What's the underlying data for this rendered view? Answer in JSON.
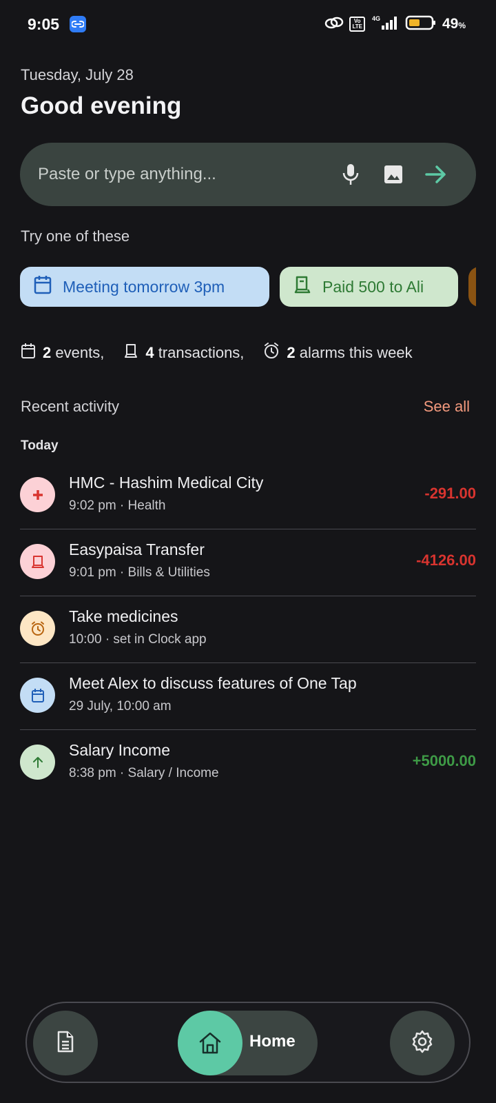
{
  "status_bar": {
    "time": "9:05",
    "network": "4G",
    "volte": "Vo\nLTE",
    "battery_percent": "49",
    "battery_unit": "%",
    "battery_level": 0.49
  },
  "header": {
    "date": "Tuesday, July 28",
    "greeting": "Good evening"
  },
  "composer": {
    "placeholder": "Paste or type anything..."
  },
  "suggestions": {
    "label": "Try one of these",
    "chips": [
      {
        "label": "Meeting tomorrow 3pm",
        "icon": "calendar-icon",
        "color": "#c3ddf5"
      },
      {
        "label": "Paid 500 to Ali",
        "icon": "receipt-icon",
        "color": "#cfe7cd"
      }
    ]
  },
  "summary": {
    "events_count": "2",
    "events_label": "events,",
    "transactions_count": "4",
    "transactions_label": "transactions,",
    "alarms_count": "2",
    "alarms_label": "alarms this week"
  },
  "recent": {
    "label": "Recent activity",
    "see_all": "See all",
    "group": "Today",
    "items": [
      {
        "title": "HMC - Hashim Medical City",
        "subtitle": "9:02 pm · Health",
        "amount": "-291.00",
        "icon": "medical-cross-icon"
      },
      {
        "title": "Easypaisa Transfer",
        "subtitle": "9:01 pm · Bills & Utilities",
        "amount": "-4126.00",
        "icon": "receipt-icon"
      },
      {
        "title": "Take medicines",
        "subtitle": "10:00 · set in Clock app",
        "amount": "",
        "icon": "alarm-icon"
      },
      {
        "title": "Meet Alex to discuss features of One Tap",
        "subtitle": "29 July, 10:00 am",
        "amount": "",
        "icon": "calendar-icon"
      },
      {
        "title": "Salary Income",
        "subtitle": "8:38 pm · Salary / Income",
        "amount": "+5000.00",
        "icon": "arrow-up-icon"
      }
    ]
  },
  "nav": {
    "home_label": "Home"
  },
  "colors": {
    "background": "#151518",
    "accent": "#5dc9a5",
    "negative": "#d8342f",
    "positive": "#3e9a46",
    "see_all": "#f49a7e"
  }
}
